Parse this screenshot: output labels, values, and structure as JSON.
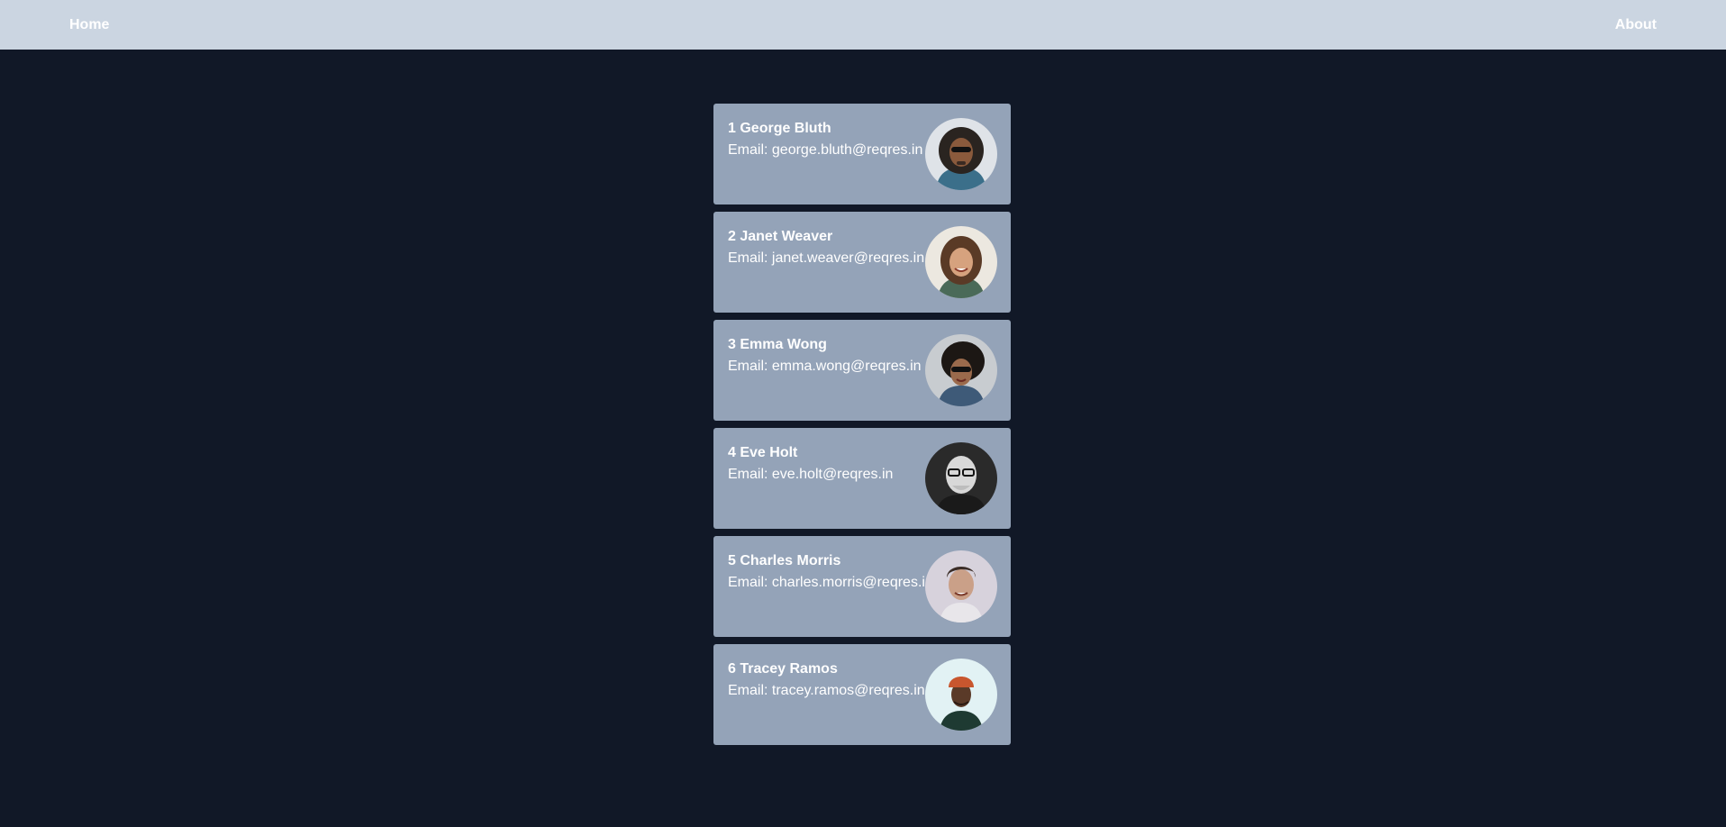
{
  "nav": {
    "home_label": "Home",
    "about_label": "About",
    "background": "#cbd5e1"
  },
  "page": {
    "background": "#111827",
    "card_color": "#94a3b8"
  },
  "users": [
    {
      "id": "1",
      "name": "George Bluth",
      "email_label": "Email:",
      "email": "george.bluth@reqres.in",
      "name_line": "1 George Bluth",
      "email_line": "Email: george.bluth@reqres.in"
    },
    {
      "id": "2",
      "name": "Janet Weaver",
      "email_label": "Email:",
      "email": "janet.weaver@reqres.in",
      "name_line": "2 Janet Weaver",
      "email_line": "Email: janet.weaver@reqres.in"
    },
    {
      "id": "3",
      "name": "Emma Wong",
      "email_label": "Email:",
      "email": "emma.wong@reqres.in",
      "name_line": "3 Emma Wong",
      "email_line": "Email: emma.wong@reqres.in"
    },
    {
      "id": "4",
      "name": "Eve Holt",
      "email_label": "Email:",
      "email": "eve.holt@reqres.in",
      "name_line": "4 Eve Holt",
      "email_line": "Email: eve.holt@reqres.in"
    },
    {
      "id": "5",
      "name": "Charles Morris",
      "email_label": "Email:",
      "email": "charles.morris@reqres.in",
      "name_line": "5 Charles Morris",
      "email_line": "Email: charles.morris@reqres.in"
    },
    {
      "id": "6",
      "name": "Tracey Ramos",
      "email_label": "Email:",
      "email": "tracey.ramos@reqres.in",
      "name_line": "6 Tracey Ramos",
      "email_line": "Email: tracey.ramos@reqres.in"
    }
  ]
}
